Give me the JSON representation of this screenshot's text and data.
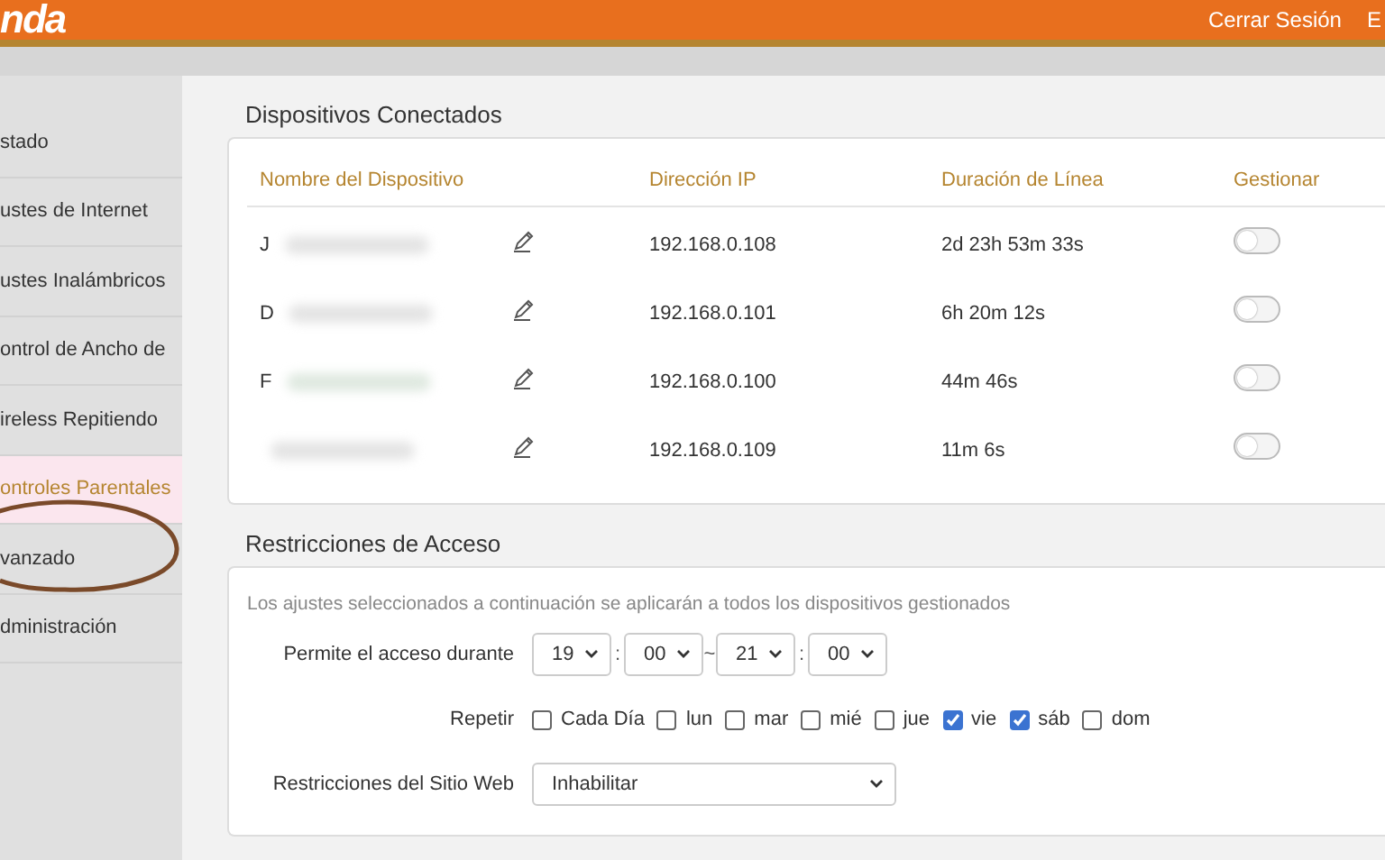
{
  "header": {
    "logo": "nda",
    "links": [
      "Cerrar Sesión",
      "E"
    ]
  },
  "sidebar": {
    "items": [
      {
        "label": "stado",
        "selected": false
      },
      {
        "label": "ustes de Internet",
        "selected": false
      },
      {
        "label": "ustes Inalámbricos",
        "selected": false
      },
      {
        "label": "ontrol de Ancho de",
        "selected": false
      },
      {
        "label": "ireless Repitiendo",
        "selected": false
      },
      {
        "label": "ontroles Parentales",
        "selected": true
      },
      {
        "label": "vanzado",
        "selected": false
      },
      {
        "label": "dministración",
        "selected": false
      }
    ]
  },
  "devices": {
    "title": "Dispositivos Conectados",
    "columns": [
      "Nombre del Dispositivo",
      "Dirección IP",
      "Duración de Línea",
      "Gestionar"
    ],
    "rows": [
      {
        "name": "J",
        "ip": "192.168.0.108",
        "duration": "2d 23h 53m 33s",
        "on": false
      },
      {
        "name": "D",
        "ip": "192.168.0.101",
        "duration": "6h 20m 12s",
        "on": false
      },
      {
        "name": "F",
        "ip": "192.168.0.100",
        "duration": "44m 46s",
        "on": false
      },
      {
        "ip": "192.168.0.109",
        "duration": "11m 6s",
        "on": false
      }
    ]
  },
  "access": {
    "title": "Restricciones de Acceso",
    "note": "Los ajustes seleccionados a continuación se aplicarán a todos los dispositivos gestionados",
    "time_label": "Permite el acceso durante",
    "times": [
      "19",
      "00",
      "21",
      "00"
    ],
    "separators": [
      ":",
      "~",
      ":"
    ],
    "repeat_label": "Repetir",
    "days": [
      {
        "label": "Cada Día",
        "checked": false
      },
      {
        "label": "lun",
        "checked": false
      },
      {
        "label": "mar",
        "checked": false
      },
      {
        "label": "mié",
        "checked": false
      },
      {
        "label": "jue",
        "checked": false
      },
      {
        "label": "vie",
        "checked": true
      },
      {
        "label": "sáb",
        "checked": true
      },
      {
        "label": "dom",
        "checked": false
      }
    ],
    "web_label": "Restricciones del Sitio Web",
    "web_value": "Inhabilitar"
  }
}
